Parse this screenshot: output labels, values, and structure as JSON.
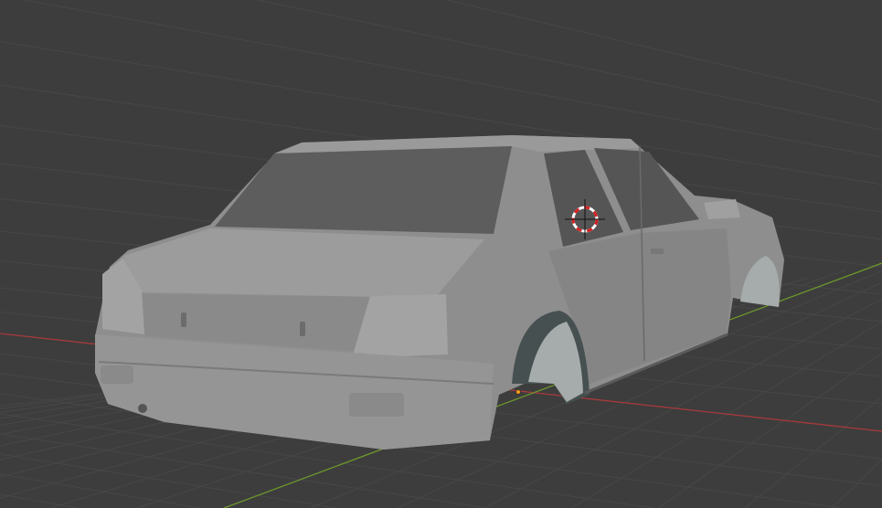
{
  "viewport": {
    "background_color": "#3d3d3d",
    "grid_color": "#4a4a4a",
    "x_axis_color": "#b03a3e",
    "y_axis_color": "#6f9a2c",
    "model_color": "#8f8f8f"
  },
  "icons": {
    "cursor": "3d-cursor-icon",
    "origin": "object-origin-icon"
  },
  "origin_color": "#f29a1a"
}
